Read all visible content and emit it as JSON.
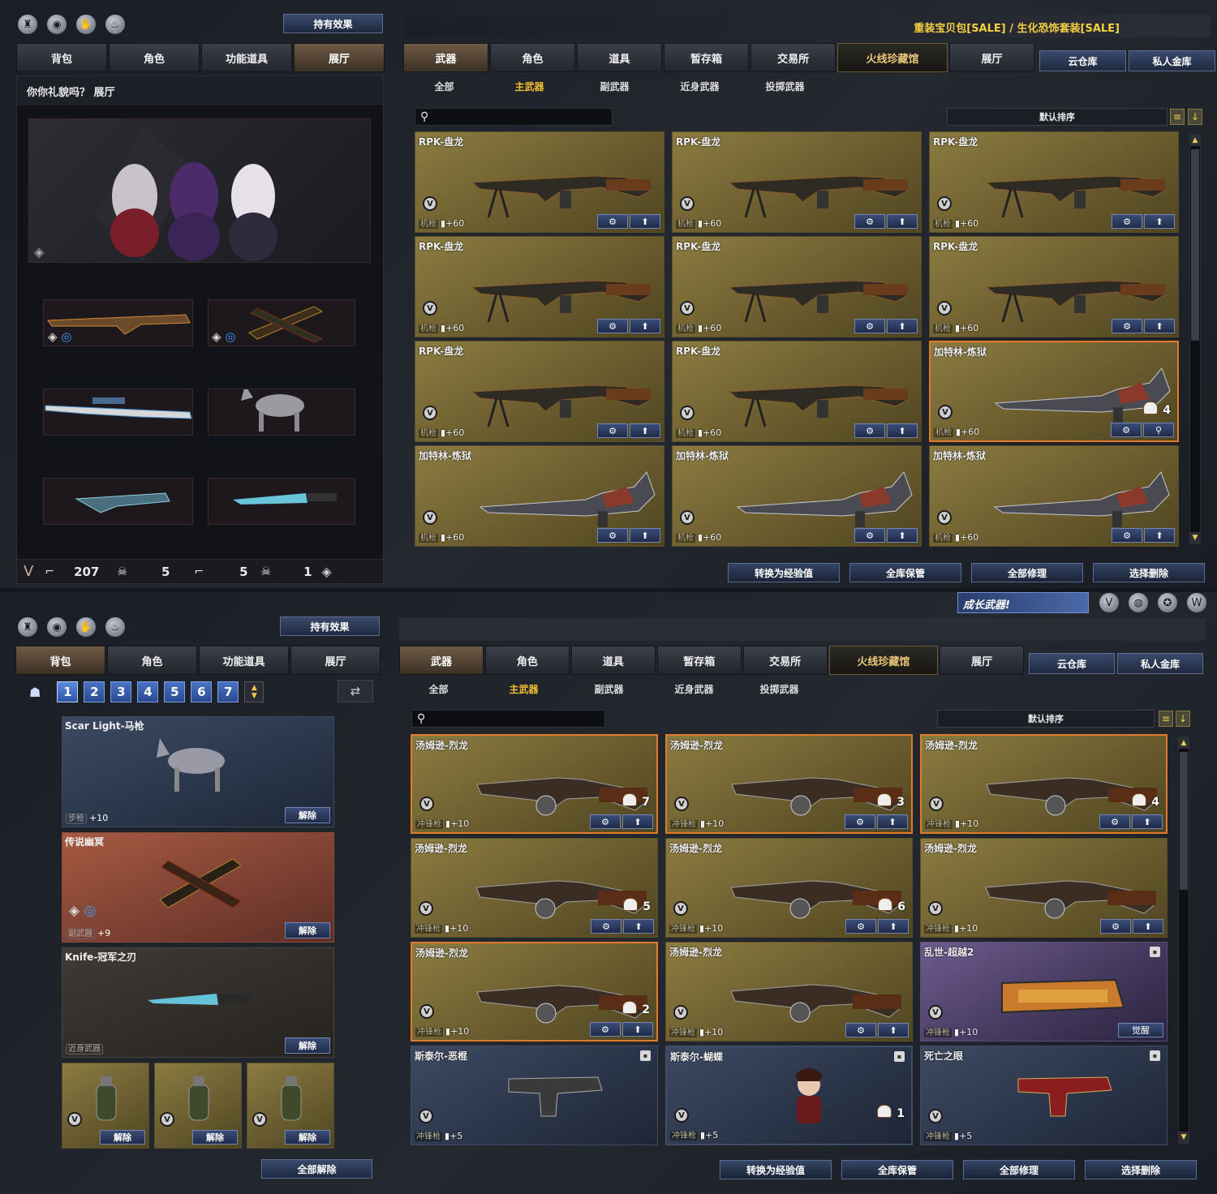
{
  "colors": {
    "accent_gold": "#f0c030",
    "selected_border": "#e07b2c",
    "blue_button": "#2c3e63"
  },
  "common": {
    "hold_effect": "持有效果",
    "left_tabs": [
      "背包",
      "角色",
      "功能道具",
      "展厅"
    ],
    "right_tabs": [
      "武器",
      "角色",
      "道具",
      "暂存箱",
      "交易所",
      "火线珍藏馆",
      "展厅"
    ],
    "storage_tabs": [
      "云仓库",
      "私人金库"
    ],
    "sub_tabs": [
      "全部",
      "主武器",
      "副武器",
      "近身武器",
      "投掷武器"
    ],
    "sort": "默认排序",
    "bottom_buttons": [
      "转换为经验值",
      "全库保管",
      "全部修理",
      "选择删除"
    ]
  },
  "s1": {
    "promo": "重装宝贝包[SALE] / 生化恐饰套装[SALE]",
    "hall_title": "你你礼貌吗？ 展厅",
    "stats": {
      "gun_count": "207",
      "skull_count": "5",
      "gun_count2": "5",
      "skull_count2": "1"
    },
    "cards": [
      {
        "name": "RPK-盘龙",
        "cat": "机枪",
        "val": "+60",
        "type": "rpk"
      },
      {
        "name": "RPK-盘龙",
        "cat": "机枪",
        "val": "+60",
        "type": "rpk"
      },
      {
        "name": "RPK-盘龙",
        "cat": "机枪",
        "val": "+60",
        "type": "rpk"
      },
      {
        "name": "RPK-盘龙",
        "cat": "机枪",
        "val": "+60",
        "type": "rpk"
      },
      {
        "name": "RPK-盘龙",
        "cat": "机枪",
        "val": "+60",
        "type": "rpk"
      },
      {
        "name": "RPK-盘龙",
        "cat": "机枪",
        "val": "+60",
        "type": "rpk"
      },
      {
        "name": "RPK-盘龙",
        "cat": "机枪",
        "val": "+60",
        "type": "rpk"
      },
      {
        "name": "RPK-盘龙",
        "cat": "机枪",
        "val": "+60",
        "type": "rpk"
      },
      {
        "name": "加特林-炼狱",
        "cat": "机枪",
        "val": "+60",
        "type": "gatling",
        "count": "4",
        "selected": true
      },
      {
        "name": "加特林-炼狱",
        "cat": "机枪",
        "val": "+60",
        "type": "gatling"
      },
      {
        "name": "加特林-炼狱",
        "cat": "机枪",
        "val": "+60",
        "type": "gatling"
      },
      {
        "name": "加特林-炼狱",
        "cat": "机枪",
        "val": "+60",
        "type": "gatling"
      }
    ]
  },
  "s2": {
    "banner": "成长武器!",
    "pages": [
      "1",
      "2",
      "3",
      "4",
      "5",
      "6",
      "7"
    ],
    "equipped": [
      {
        "name": "Scar Light-马枪",
        "cat": "步枪",
        "val": "+10",
        "remove": "解除"
      },
      {
        "name": "传说幽冥",
        "cat": "副武器",
        "val": "+9",
        "remove": "解除"
      },
      {
        "name": "Knife-冠军之刃",
        "cat": "近身武器",
        "val": "",
        "remove": "解除"
      }
    ],
    "grenade_remove": "解除",
    "remove_all": "全部解除",
    "cards": [
      {
        "name": "汤姆逊-烈龙",
        "cat": "冲锋枪",
        "val": "+10",
        "type": "tommy",
        "count": "7",
        "style": "gold_sel"
      },
      {
        "name": "汤姆逊-烈龙",
        "cat": "冲锋枪",
        "val": "+10",
        "type": "tommy",
        "count": "3",
        "style": "gold_sel"
      },
      {
        "name": "汤姆逊-烈龙",
        "cat": "冲锋枪",
        "val": "+10",
        "type": "tommy",
        "count": "4",
        "style": "gold_sel"
      },
      {
        "name": "汤姆逊-烈龙",
        "cat": "冲锋枪",
        "val": "+10",
        "type": "tommy",
        "count": "5",
        "style": "gold"
      },
      {
        "name": "汤姆逊-烈龙",
        "cat": "冲锋枪",
        "val": "+10",
        "type": "tommy",
        "count": "6",
        "style": "gold"
      },
      {
        "name": "汤姆逊-烈龙",
        "cat": "冲锋枪",
        "val": "+10",
        "type": "tommy",
        "style": "gold"
      },
      {
        "name": "汤姆逊-烈龙",
        "cat": "冲锋枪",
        "val": "+10",
        "type": "tommy",
        "count": "2",
        "style": "gold_sel"
      },
      {
        "name": "汤姆逊-烈龙",
        "cat": "冲锋枪",
        "val": "+10",
        "type": "tommy",
        "style": "gold"
      },
      {
        "name": "乱世-超越2",
        "cat": "冲锋枪",
        "val": "+10",
        "type": "p90",
        "style": "purple",
        "action": "觉醒"
      },
      {
        "name": "斯泰尔-恶棍",
        "cat": "冲锋枪",
        "val": "+5",
        "type": "uzi",
        "style": "blue"
      },
      {
        "name": "斯泰尔-蝴蝶",
        "cat": "冲锋枪",
        "val": "+5",
        "type": "char",
        "count": "1",
        "style": "blue_sel"
      },
      {
        "name": "死亡之眼",
        "cat": "冲锋枪",
        "val": "+5",
        "type": "uzi_red",
        "style": "blue"
      }
    ]
  }
}
